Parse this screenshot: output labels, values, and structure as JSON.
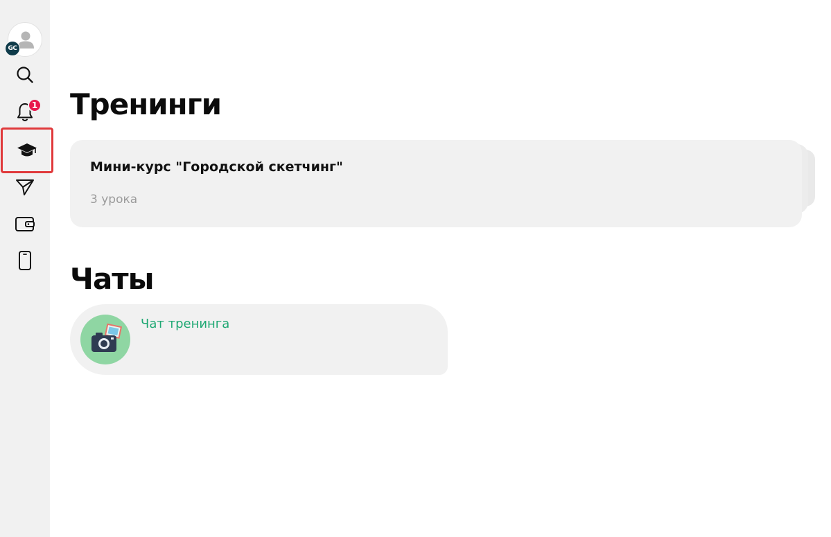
{
  "sidebar": {
    "avatar_logo": "GC",
    "notifications_badge": "1"
  },
  "trainings": {
    "title": "Тренинги",
    "course": {
      "name": "Мини-курс \"Городской скетчинг\"",
      "lessons": "3 урока"
    }
  },
  "chats": {
    "title": "Чаты",
    "item": {
      "name": "Чат тренинга"
    }
  },
  "colors": {
    "accent_green": "#1fa873",
    "badge_red": "#e8174d",
    "highlight_outline": "#e0393b"
  }
}
